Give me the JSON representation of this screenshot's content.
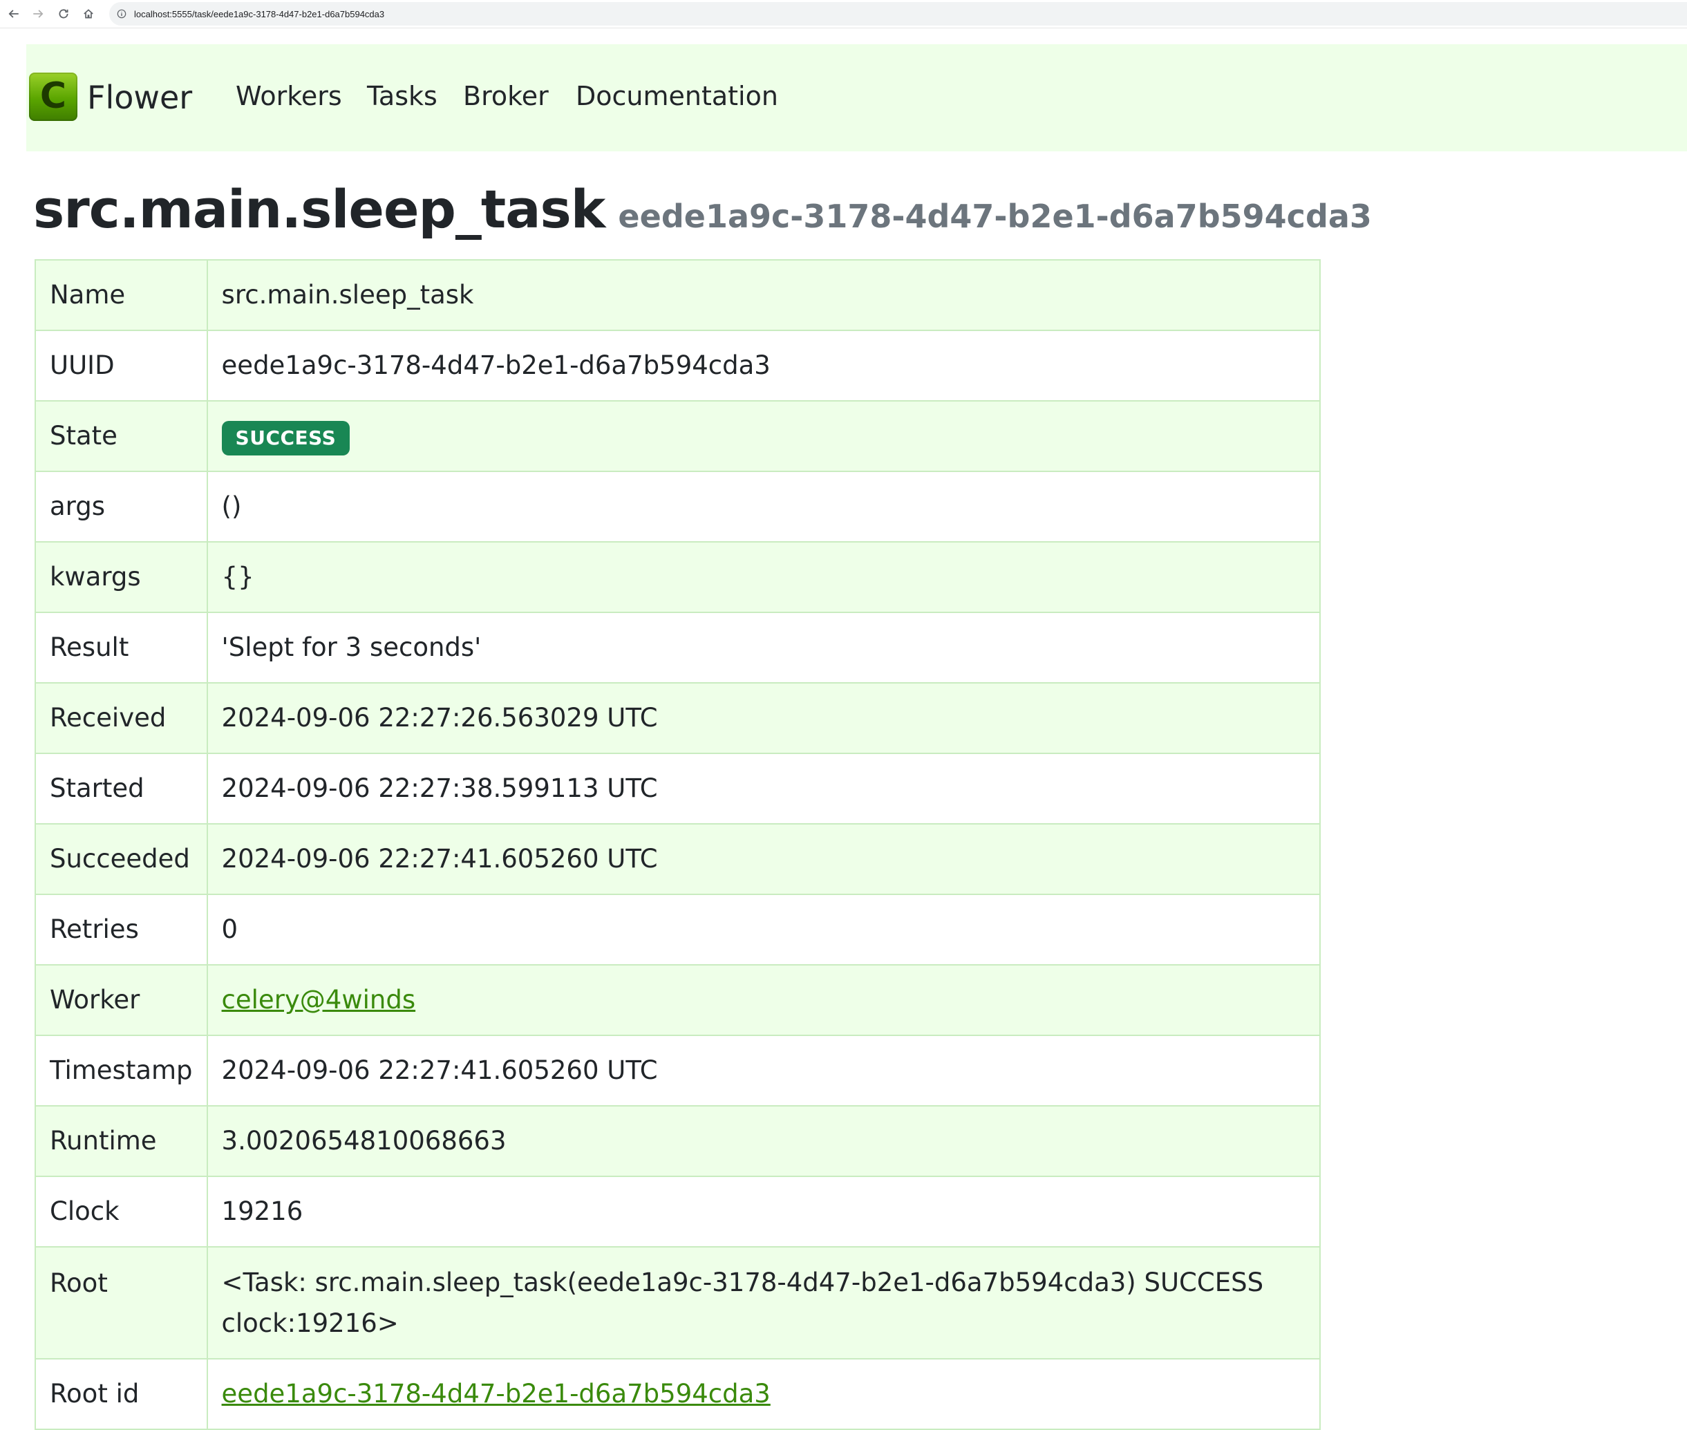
{
  "browser": {
    "url": "localhost:5555/task/eede1a9c-3178-4d47-b2e1-d6a7b594cda3"
  },
  "navbar": {
    "logo_letter": "C",
    "brand": "Flower",
    "links": [
      "Workers",
      "Tasks",
      "Broker",
      "Documentation"
    ]
  },
  "heading": {
    "title": "src.main.sleep_task",
    "subtitle": "eede1a9c-3178-4d47-b2e1-d6a7b594cda3"
  },
  "details": {
    "name": {
      "key": "Name",
      "value": "src.main.sleep_task"
    },
    "uuid": {
      "key": "UUID",
      "value": "eede1a9c-3178-4d47-b2e1-d6a7b594cda3"
    },
    "state": {
      "key": "State",
      "value": "SUCCESS"
    },
    "args": {
      "key": "args",
      "value": "()"
    },
    "kwargs": {
      "key": "kwargs",
      "value": "{}"
    },
    "result": {
      "key": "Result",
      "value": "'Slept for 3 seconds'"
    },
    "received": {
      "key": "Received",
      "value": "2024-09-06 22:27:26.563029 UTC"
    },
    "started": {
      "key": "Started",
      "value": "2024-09-06 22:27:38.599113 UTC"
    },
    "succeeded": {
      "key": "Succeeded",
      "value": "2024-09-06 22:27:41.605260 UTC"
    },
    "retries": {
      "key": "Retries",
      "value": "0"
    },
    "worker": {
      "key": "Worker",
      "value": "celery@4winds"
    },
    "timestamp": {
      "key": "Timestamp",
      "value": "2024-09-06 22:27:41.605260 UTC"
    },
    "runtime": {
      "key": "Runtime",
      "value": "3.0020654810068663"
    },
    "clock": {
      "key": "Clock",
      "value": "19216"
    },
    "root": {
      "key": "Root",
      "value": "<Task: src.main.sleep_task(eede1a9c-3178-4d47-b2e1-d6a7b594cda3) SUCCESS clock:19216>"
    },
    "root_id": {
      "key": "Root id",
      "value": "eede1a9c-3178-4d47-b2e1-d6a7b594cda3"
    }
  },
  "colors": {
    "navbar_bg": "#eeffe8",
    "row_shaded": "#eeffe8",
    "border": "#c9ecc0",
    "success_badge": "#198754",
    "link": "#3a8a0c"
  }
}
